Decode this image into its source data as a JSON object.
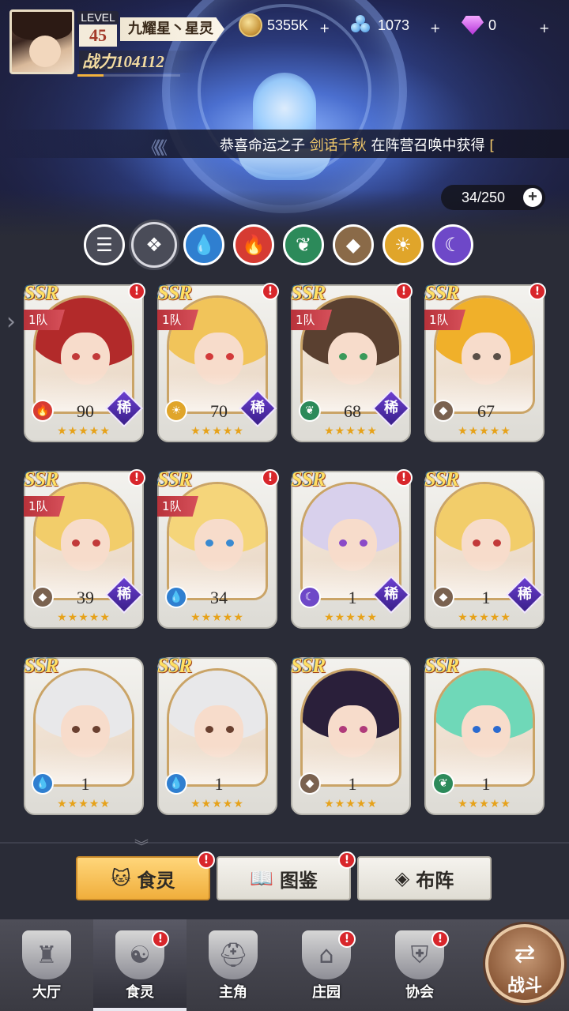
{
  "header": {
    "level_word": "LEVEL",
    "level": "45",
    "player_name": "九耀星丶星灵",
    "power": "战力104112",
    "exp_fraction": 0.25
  },
  "resources": {
    "gold": "5355K",
    "crystals": "1073",
    "diamonds": "0",
    "plus": "+"
  },
  "ticker": {
    "prefix": "恭喜命运之子",
    "highlight": "剑话千秋",
    "suffix": "在阵营召唤中获得",
    "tail": "[",
    "chevrons": "《《《"
  },
  "roster_count": "34/250",
  "filters": [
    {
      "name": "all",
      "icon": "list-icon",
      "color": "#4a4c58",
      "glyph": "☰"
    },
    {
      "name": "generic",
      "icon": "diamond-grid-icon",
      "color": "#4a4c58",
      "glyph": "❖"
    },
    {
      "name": "water",
      "icon": "water-drop-icon",
      "color": "#2f7fd0",
      "glyph": "💧"
    },
    {
      "name": "fire",
      "icon": "flame-icon",
      "color": "#d63b32",
      "glyph": "🔥"
    },
    {
      "name": "wind",
      "icon": "leaf-icon",
      "color": "#2c8a5a",
      "glyph": "❦"
    },
    {
      "name": "earth",
      "icon": "crystal-icon",
      "color": "#8a6a48",
      "glyph": "◆"
    },
    {
      "name": "light",
      "icon": "sun-icon",
      "color": "#e0a52a",
      "glyph": "☀"
    },
    {
      "name": "dark",
      "icon": "moon-icon",
      "color": "#6e48c8",
      "glyph": "☾"
    }
  ],
  "cards": [
    {
      "rarity": "SSR",
      "team": "1队",
      "level": "90",
      "element": "fire",
      "rare_badge": "稀",
      "hair": "#b22a2a",
      "eye": "#c23a3a",
      "alert": "!",
      "stars": "★★★★★"
    },
    {
      "rarity": "SSR",
      "team": "1队",
      "level": "70",
      "element": "light",
      "rare_badge": "稀",
      "hair": "#f1c45a",
      "eye": "#d23a3a",
      "alert": "!",
      "stars": "★★★★★"
    },
    {
      "rarity": "SSR",
      "team": "1队",
      "level": "68",
      "element": "wind",
      "rare_badge": "稀",
      "hair": "#5a4030",
      "eye": "#3a9a5a",
      "alert": "!",
      "stars": "★★★★★"
    },
    {
      "rarity": "SSR",
      "team": "1队",
      "level": "67",
      "element": "earth",
      "rare_badge": "",
      "hair": "#f0b02a",
      "eye": "#5a5048",
      "alert": "!",
      "stars": "★★★★★"
    },
    {
      "rarity": "SSR",
      "team": "1队",
      "level": "39",
      "element": "earth",
      "rare_badge": "稀",
      "hair": "#f2cd6a",
      "eye": "#c23a3a",
      "alert": "!",
      "stars": "★★★★★"
    },
    {
      "rarity": "SSR",
      "team": "1队",
      "level": "34",
      "element": "water",
      "rare_badge": "",
      "hair": "#f5d57a",
      "eye": "#3a8ad0",
      "alert": "!",
      "stars": "★★★★★"
    },
    {
      "rarity": "SSR",
      "team": "",
      "level": "1",
      "element": "dark",
      "rare_badge": "稀",
      "hair": "#d8d0ec",
      "eye": "#8a4ac8",
      "alert": "!",
      "stars": "★★★★★"
    },
    {
      "rarity": "SSR",
      "team": "",
      "level": "1",
      "element": "earth",
      "rare_badge": "稀",
      "hair": "#f2cd6a",
      "eye": "#c23a3a",
      "alert": "",
      "stars": "★★★★★"
    },
    {
      "rarity": "SSR",
      "team": "",
      "level": "1",
      "element": "water",
      "rare_badge": "",
      "hair": "#e8e8ea",
      "eye": "#6a4030",
      "alert": "",
      "stars": "★★★★★"
    },
    {
      "rarity": "SSR",
      "team": "",
      "level": "1",
      "element": "water",
      "rare_badge": "",
      "hair": "#e8e8ea",
      "eye": "#6a4030",
      "alert": "",
      "stars": "★★★★★"
    },
    {
      "rarity": "SSR",
      "team": "",
      "level": "1",
      "element": "earth",
      "rare_badge": "",
      "hair": "#2a1f3a",
      "eye": "#b03a7a",
      "alert": "",
      "stars": "★★★★★"
    },
    {
      "rarity": "SSR",
      "team": "",
      "level": "1",
      "element": "wind",
      "rare_badge": "",
      "hair": "#6fd8b8",
      "eye": "#2a6ad0",
      "alert": "",
      "stars": "★★★★★"
    }
  ],
  "element_colors": {
    "fire": "#d63b32",
    "light": "#e0a52a",
    "wind": "#2c8a5a",
    "earth": "#7a6250",
    "water": "#2f7fd0",
    "dark": "#6e48c8"
  },
  "element_glyphs": {
    "fire": "🔥",
    "light": "☀",
    "wind": "❦",
    "earth": "◆",
    "water": "💧",
    "dark": "☾"
  },
  "subtabs": [
    {
      "label": "食灵",
      "icon": "cat-icon",
      "glyph": "🐱",
      "active": true,
      "alert": "!"
    },
    {
      "label": "图鉴",
      "icon": "book-icon",
      "glyph": "📖",
      "active": false,
      "alert": "!"
    },
    {
      "label": "布阵",
      "icon": "formation-icon",
      "glyph": "◈",
      "active": false,
      "alert": ""
    }
  ],
  "nav": [
    {
      "label": "大厅",
      "icon": "castle-icon",
      "glyph": "♜",
      "active": false,
      "alert": ""
    },
    {
      "label": "食灵",
      "icon": "cat-spirit-icon",
      "glyph": "☯",
      "active": true,
      "alert": "!"
    },
    {
      "label": "主角",
      "icon": "helmet-icon",
      "glyph": "⛑",
      "active": false,
      "alert": ""
    },
    {
      "label": "庄园",
      "icon": "house-icon",
      "glyph": "⌂",
      "active": false,
      "alert": "!"
    },
    {
      "label": "协会",
      "icon": "shield-icon",
      "glyph": "⛨",
      "active": false,
      "alert": "!"
    }
  ],
  "battle_button": {
    "label": "战斗",
    "arrows": "⇄"
  }
}
